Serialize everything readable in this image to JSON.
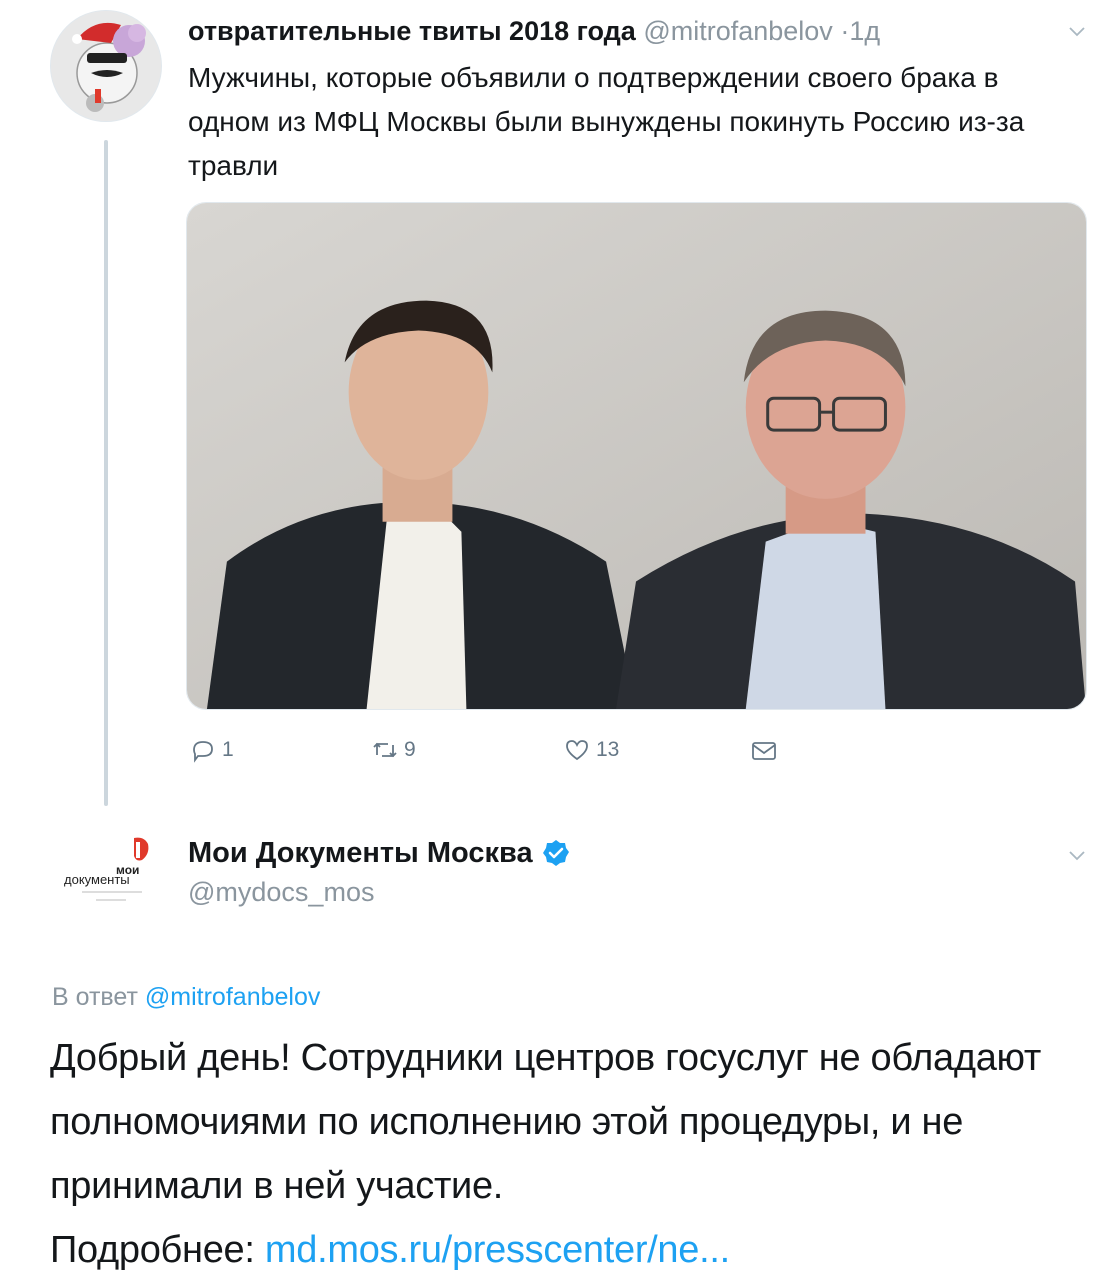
{
  "tweet1": {
    "author_name": "отвратительные твиты 2018 года",
    "author_handle": "@mitrofanbelov",
    "separator": "·",
    "time": "1д",
    "text": "Мужчины, которые объявили о подтверждении своего брака в одном из МФЦ Москвы были вынуждены покинуть Россию из-за травли",
    "actions": {
      "reply_count": "1",
      "retweet_count": "9",
      "like_count": "13"
    }
  },
  "tweet2": {
    "logo_text": "мои документы",
    "author_name": "Мои Документы Москва",
    "author_handle": "@mydocs_mos",
    "reply_prefix": "В ответ",
    "reply_handle": "@mitrofanbelov",
    "text": "Добрый день! Сотрудники центров госуслуг не обладают полномочиями по исполнению этой процедуры, и не принимали в ней участие.",
    "more_prefix": "Подробнее:",
    "link_text": "md.mos.ru/presscenter/ne..."
  },
  "icons": {
    "caret": "chevron-down-icon",
    "reply": "reply-icon",
    "retweet": "retweet-icon",
    "like": "heart-icon",
    "dm": "envelope-icon",
    "verified": "verified-badge-icon"
  },
  "colors": {
    "link": "#1da1f2",
    "muted": "#8a959e",
    "icon": "#657786",
    "thread_line": "#ccd6dd",
    "logo_red": "#e0392b"
  }
}
